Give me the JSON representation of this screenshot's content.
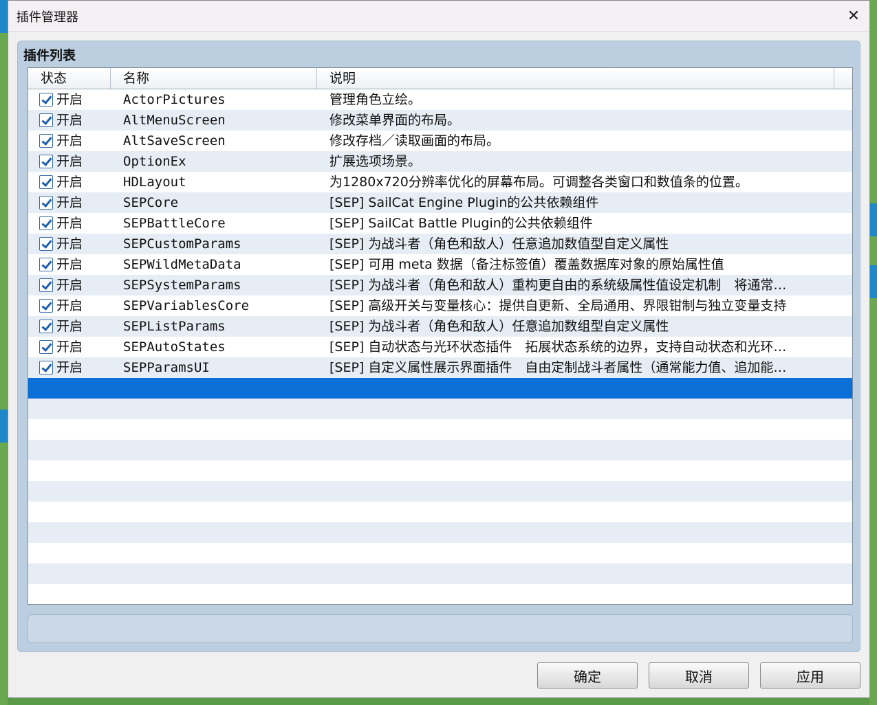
{
  "window": {
    "title": "插件管理器"
  },
  "group": {
    "title": "插件列表"
  },
  "columns": {
    "status": "状态",
    "name": "名称",
    "description": "说明"
  },
  "plugins": [
    {
      "status": "开启",
      "name": "ActorPictures",
      "description": "管理角色立绘。"
    },
    {
      "status": "开启",
      "name": "AltMenuScreen",
      "description": "修改菜单界面的布局。"
    },
    {
      "status": "开启",
      "name": "AltSaveScreen",
      "description": "修改存档／读取画面的布局。"
    },
    {
      "status": "开启",
      "name": "OptionEx",
      "description": "扩展选项场景。"
    },
    {
      "status": "开启",
      "name": "HDLayout",
      "description": "为1280x720分辨率优化的屏幕布局。可调整各类窗口和数值条的位置。"
    },
    {
      "status": "开启",
      "name": "SEPCore",
      "description": "[SEP] SailCat Engine Plugin的公共依赖组件"
    },
    {
      "status": "开启",
      "name": "SEPBattleCore",
      "description": "[SEP] SailCat Battle Plugin的公共依赖组件"
    },
    {
      "status": "开启",
      "name": "SEPCustomParams",
      "description": "[SEP] 为战斗者（角色和敌人）任意追加数值型自定义属性"
    },
    {
      "status": "开启",
      "name": "SEPWildMetaData",
      "description": "[SEP] 可用 meta 数据（备注标签值）覆盖数据库对象的原始属性值"
    },
    {
      "status": "开启",
      "name": "SEPSystemParams",
      "description": "[SEP] 为战斗者（角色和敌人）重构更自由的系统级属性值设定机制　将通常…"
    },
    {
      "status": "开启",
      "name": "SEPVariablesCore",
      "description": "[SEP] 高级开关与变量核心：提供自更新、全局通用、界限钳制与独立变量支持"
    },
    {
      "status": "开启",
      "name": "SEPListParams",
      "description": "[SEP] 为战斗者（角色和敌人）任意追加数组型自定义属性"
    },
    {
      "status": "开启",
      "name": "SEPAutoStates",
      "description": "[SEP] 自动状态与光环状态插件　拓展状态系统的边界，支持自动状态和光环…"
    },
    {
      "status": "开启",
      "name": "SEPParamsUI",
      "description": "[SEP] 自定义属性展示界面插件　自由定制战斗者属性（通常能力值、追加能…"
    }
  ],
  "buttons": {
    "ok": "确定",
    "cancel": "取消",
    "apply": "应用"
  },
  "colors": {
    "selection": "#0a6fd6",
    "group_bg": "#bccfe0",
    "stripe": "#e6edf5"
  }
}
